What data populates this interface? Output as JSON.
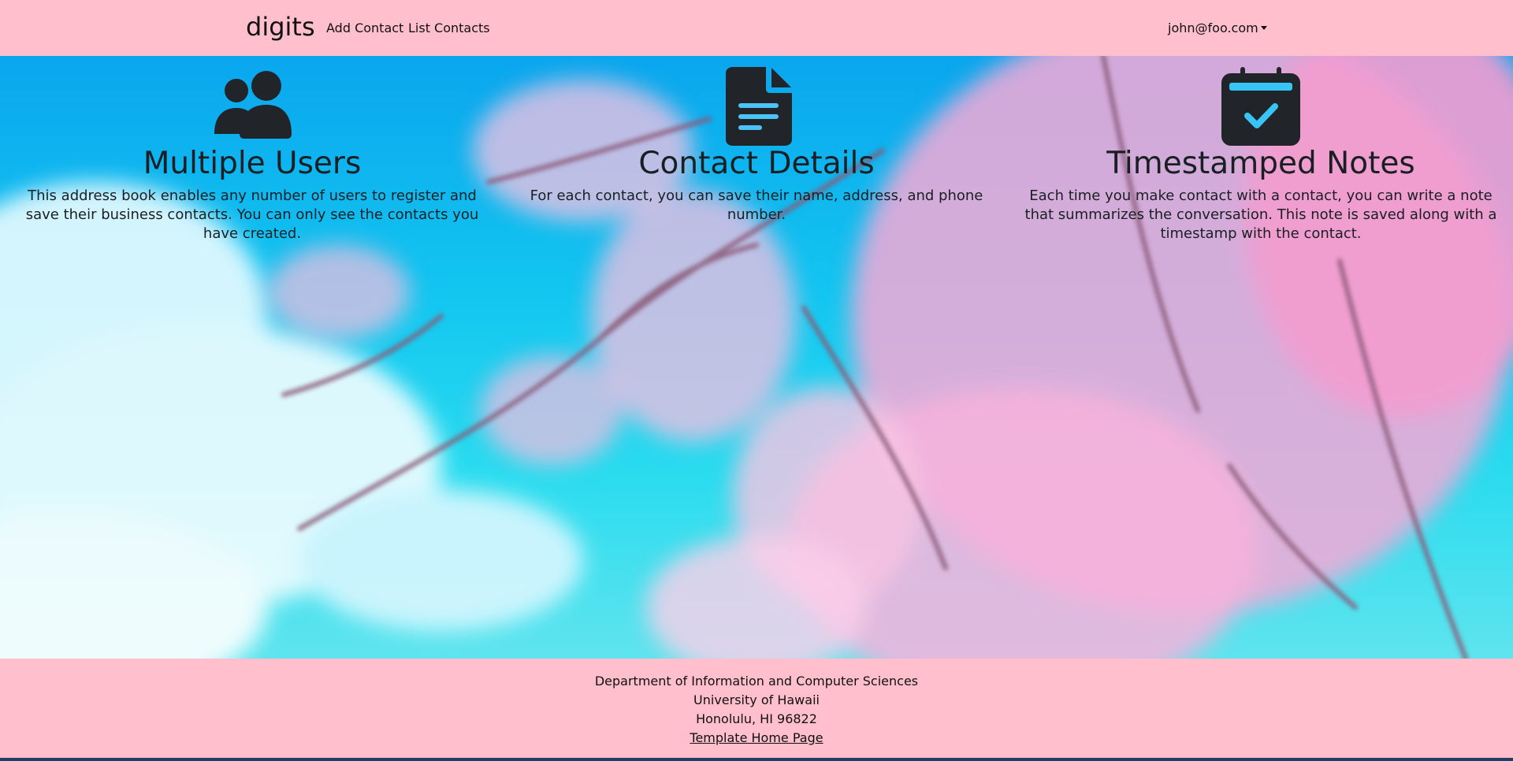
{
  "navbar": {
    "brand": "digits",
    "links": [
      {
        "label": "Add Contact"
      },
      {
        "label": "List Contacts"
      }
    ],
    "user_menu": "john@foo.com"
  },
  "features": [
    {
      "icon": "users-icon",
      "title": "Multiple Users",
      "text": "This address book enables any number of users to register and save their business contacts. You can only see the contacts you have created."
    },
    {
      "icon": "file-text-icon",
      "title": "Contact Details",
      "text": "For each contact, you can save their name, address, and phone number."
    },
    {
      "icon": "calendar-check-icon",
      "title": "Timestamped Notes",
      "text": "Each time you make contact with a contact, you can write a note that summarizes the conversation. This note is saved along with a timestamp with the contact."
    }
  ],
  "footer": {
    "lines": [
      "Department of Information and Computer Sciences",
      "University of Hawaii",
      "Honolulu, HI 96822"
    ],
    "link": "Template Home Page"
  },
  "colors": {
    "navbar_bg": "#ffbfcc",
    "footer_bg": "#ffbfcc",
    "icon": "#212529"
  }
}
